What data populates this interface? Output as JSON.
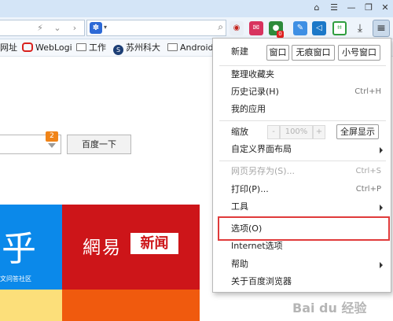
{
  "window": {
    "buttons": [
      "⌂",
      "☰",
      "—",
      "❐",
      "✕"
    ]
  },
  "toolbar": {
    "nav": [
      "⚡",
      "⌄",
      "›"
    ],
    "search_icon": "⌕"
  },
  "bookmarks": [
    {
      "label": "网址",
      "icon": "none"
    },
    {
      "label": "WebLogi",
      "icon": "weblogic-logo"
    },
    {
      "label": "工作",
      "icon": "folder-icon"
    },
    {
      "label": "苏州科大",
      "icon": "school-logo"
    },
    {
      "label": "Android",
      "icon": "folder-icon"
    }
  ],
  "page": {
    "badge": "2",
    "baidu_button": "百度一下",
    "zhihu_char": "乎",
    "zhihu_sub": "文问答社区",
    "netease_a": "網易",
    "netease_b": "新闻"
  },
  "menu": {
    "new_label": "新建",
    "new_buttons": [
      "窗口",
      "无痕窗口",
      "小号窗口"
    ],
    "items1": [
      {
        "label": "整理收藏夹",
        "shortcut": ""
      },
      {
        "label": "历史记录(H)",
        "shortcut": "Ctrl+H"
      },
      {
        "label": "我的应用",
        "shortcut": ""
      }
    ],
    "zoom_label": "缩放",
    "zoom_minus": "-",
    "zoom_value": "100%",
    "zoom_plus": "+",
    "fullscreen": "全屏显示",
    "custom_layout": "自定义界面布局",
    "items2": [
      {
        "label": "网页另存为(S)...",
        "shortcut": "Ctrl+S",
        "disabled": true
      },
      {
        "label": "打印(P)...",
        "shortcut": "Ctrl+P",
        "disabled": false
      },
      {
        "label": "工具",
        "shortcut": "",
        "disabled": false
      }
    ],
    "items3": [
      {
        "label": "选项(O)"
      },
      {
        "label": "Internet选项"
      },
      {
        "label": "帮助"
      },
      {
        "label": "关于百度浏览器"
      }
    ]
  },
  "watermark": "Bai du 经验",
  "colors": {
    "highlight": "#e03b3b",
    "zhihu": "#0b89ea",
    "netease": "#cd1519",
    "badge": "#f08418"
  }
}
